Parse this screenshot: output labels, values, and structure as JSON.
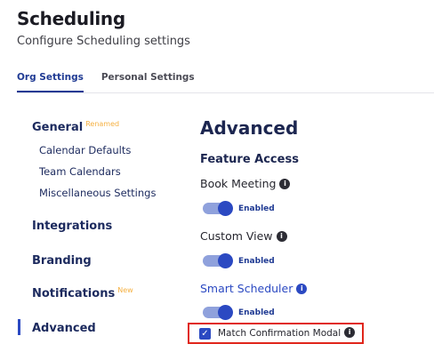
{
  "header": {
    "title": "Scheduling",
    "subtitle": "Configure Scheduling settings"
  },
  "tabs": [
    {
      "label": "Org Settings",
      "active": true
    },
    {
      "label": "Personal Settings",
      "active": false
    }
  ],
  "sidebar": {
    "general": {
      "label": "General",
      "badge": "Renamed"
    },
    "general_items": [
      "Calendar Defaults",
      "Team Calendars",
      "Miscellaneous Settings"
    ],
    "integrations": "Integrations",
    "branding": "Branding",
    "notifications": {
      "label": "Notifications",
      "badge": "New"
    },
    "advanced": "Advanced"
  },
  "main": {
    "title": "Advanced",
    "subtitle": "Feature Access",
    "features": [
      {
        "label": "Book Meeting",
        "state": "Enabled",
        "on": true
      },
      {
        "label": "Custom View",
        "state": "Enabled",
        "on": true
      },
      {
        "label": "Smart Scheduler",
        "state": "Enabled",
        "on": true
      }
    ],
    "checkbox": {
      "label": "Match Confirmation Modal",
      "checked": true
    }
  },
  "colors": {
    "accent": "#2b49c2",
    "badge_orange": "#f5b041",
    "highlight_red": "#e0261b"
  }
}
